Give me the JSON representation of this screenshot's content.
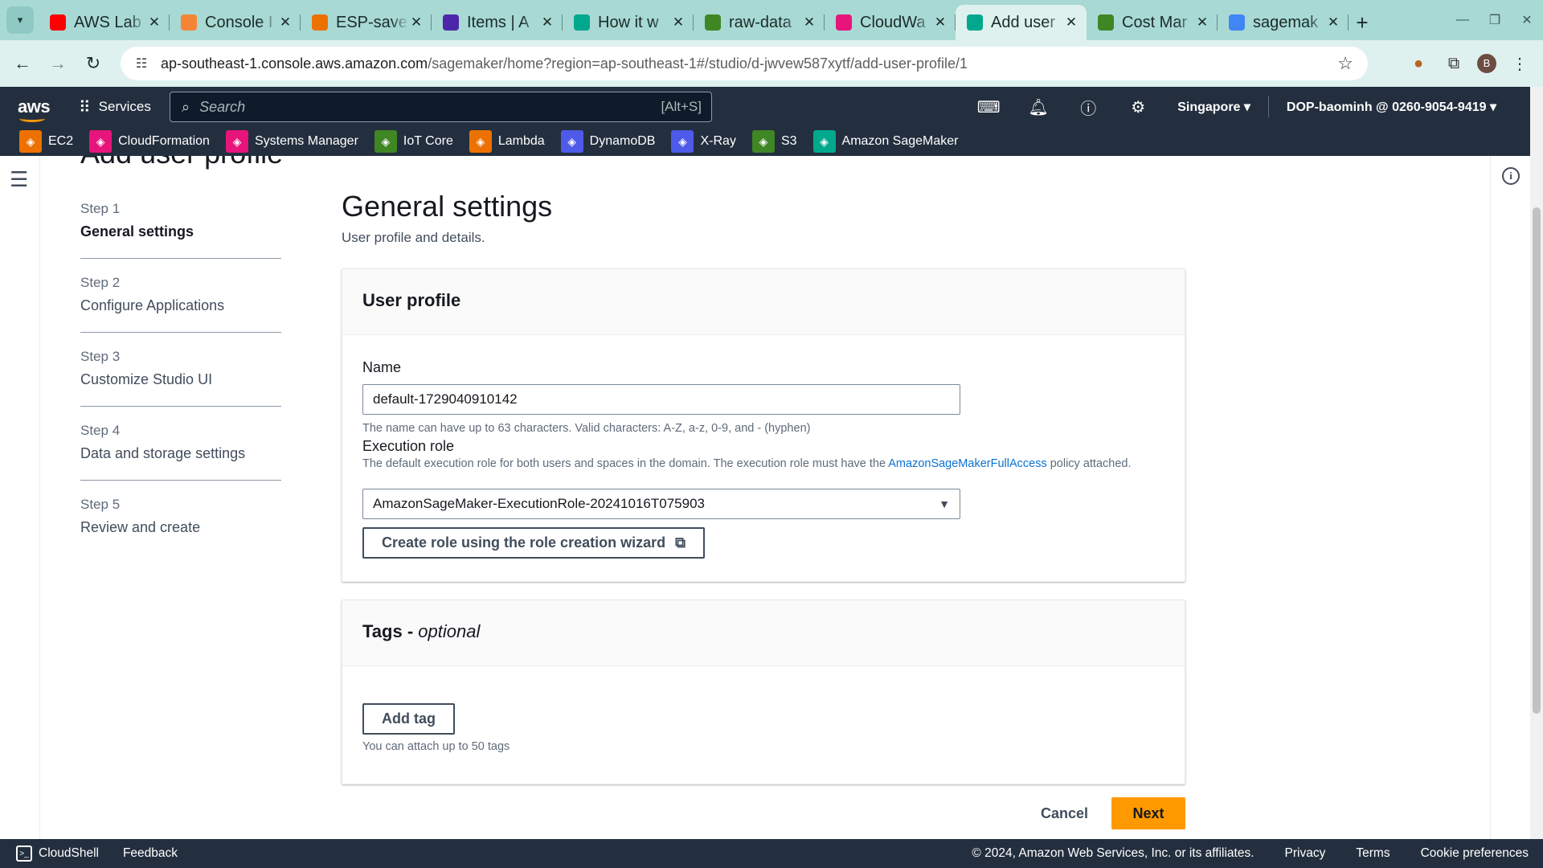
{
  "browser": {
    "tabs": [
      {
        "title": "AWS Lab",
        "favicon_color": "#ff0000"
      },
      {
        "title": "Console I",
        "favicon_color": "#f58536"
      },
      {
        "title": "ESP-save",
        "favicon_color": "#ed7100"
      },
      {
        "title": "Items | A",
        "favicon_color": "#4d27aa"
      },
      {
        "title": "How it w",
        "favicon_color": "#01a88d"
      },
      {
        "title": "raw-data",
        "favicon_color": "#3f8624"
      },
      {
        "title": "CloudWa",
        "favicon_color": "#e7157b"
      },
      {
        "title": "Add user",
        "favicon_color": "#01a88d"
      },
      {
        "title": "Cost Mar",
        "favicon_color": "#3f8624"
      },
      {
        "title": "sagemak",
        "favicon_color": "#4285f4"
      }
    ],
    "active_tab_index": 7,
    "url_host": "ap-southeast-1.console.aws.amazon.com",
    "url_path": "/sagemaker/home?region=ap-southeast-1#/studio/d-jwvew587xytf/add-user-profile/1",
    "profile_initial": "B"
  },
  "aws_nav": {
    "logo": "aws",
    "services_label": "Services",
    "search_placeholder": "Search",
    "search_shortcut": "[Alt+S]",
    "region": "Singapore",
    "account": "DOP-baominh @ 0260-9054-9419"
  },
  "favorites": [
    {
      "label": "EC2",
      "color": "#ed7100"
    },
    {
      "label": "CloudFormation",
      "color": "#e7157b"
    },
    {
      "label": "Systems Manager",
      "color": "#e7157b"
    },
    {
      "label": "IoT Core",
      "color": "#3f8624"
    },
    {
      "label": "Lambda",
      "color": "#ed7100"
    },
    {
      "label": "DynamoDB",
      "color": "#4d5be8"
    },
    {
      "label": "X-Ray",
      "color": "#4d5be8"
    },
    {
      "label": "S3",
      "color": "#3f8624"
    },
    {
      "label": "Amazon SageMaker",
      "color": "#01a88d"
    }
  ],
  "page": {
    "title": "Add user profile",
    "steps": [
      {
        "num": "Step 1",
        "label": "General settings"
      },
      {
        "num": "Step 2",
        "label": "Configure Applications"
      },
      {
        "num": "Step 3",
        "label": "Customize Studio UI"
      },
      {
        "num": "Step 4",
        "label": "Data and storage settings"
      },
      {
        "num": "Step 5",
        "label": "Review and create"
      }
    ],
    "active_step": 0,
    "main_title": "General settings",
    "main_desc": "User profile and details.",
    "user_profile": {
      "heading": "User profile",
      "name_label": "Name",
      "name_value": "default-1729040910142",
      "name_hint": "The name can have up to 63 characters. Valid characters: A-Z, a-z, 0-9, and - (hyphen)",
      "role_label": "Execution role",
      "role_desc_pre": "The default execution role for both users and spaces in the domain. The execution role must have the ",
      "role_desc_link": "AmazonSageMakerFullAccess",
      "role_desc_post": " policy attached.",
      "role_value": "AmazonSageMaker-ExecutionRole-20241016T075903",
      "role_wizard_label": "Create role using the role creation wizard"
    },
    "tags": {
      "heading": "Tags",
      "heading_suffix": "optional",
      "add_tag_label": "Add tag",
      "hint": "You can attach up to 50 tags"
    },
    "cancel_label": "Cancel",
    "next_label": "Next"
  },
  "footer": {
    "cloudshell": "CloudShell",
    "feedback": "Feedback",
    "copyright": "© 2024, Amazon Web Services, Inc. or its affiliates.",
    "privacy": "Privacy",
    "terms": "Terms",
    "cookies": "Cookie preferences"
  },
  "icons": [
    "tab-search-icon",
    "back-arrow-icon",
    "forward-arrow-icon",
    "reload-icon",
    "site-settings-icon",
    "bookmark-star-icon",
    "extension-icon",
    "services-grid-icon",
    "search-icon",
    "cloudshell-icon",
    "notifications-bell-icon",
    "help-icon",
    "settings-gear-icon",
    "hamburger-menu-icon",
    "info-icon",
    "external-link-icon",
    "dropdown-caret-icon"
  ]
}
